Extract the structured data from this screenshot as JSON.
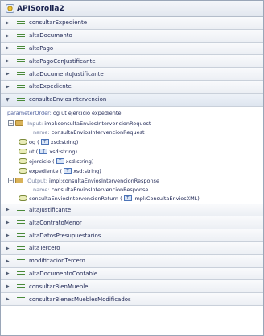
{
  "header": {
    "title": "APISorolla2"
  },
  "operations_before": [
    {
      "label": "consultarExpediente"
    },
    {
      "label": "altaDocumento"
    },
    {
      "label": "altaPago"
    },
    {
      "label": "altaPagoConJustificante"
    },
    {
      "label": "altaDocumentoJustificante"
    },
    {
      "label": "altaExpediente"
    }
  ],
  "expanded": {
    "label": "consultaEnviosIntervencion",
    "param_key": "parameterOrder:",
    "param_value": "og ut ejercicio expediente",
    "input": {
      "key": "Input:",
      "value": "impl:consultaEnviosIntervencionRequest",
      "name_key": "name:",
      "name_value": "consultaEnviosIntervencionRequest",
      "parts": [
        {
          "name": "og (",
          "type_icon": "T",
          "type": "xsd:string)"
        },
        {
          "name": "ut (",
          "type_icon": "T",
          "type": "xsd:string)"
        },
        {
          "name": "ejercicio (",
          "type_icon": "T",
          "type": "xsd:string)"
        },
        {
          "name": "expediente (",
          "type_icon": "T",
          "type": "xsd:string)"
        }
      ]
    },
    "output": {
      "key": "Output:",
      "value": "impl:consultaEnviosIntervencionResponse",
      "name_key": "name:",
      "name_value": "consultaEnviosIntervencionResponse",
      "part": {
        "name": "consultaEnviosIntervencionReturn (",
        "type_icon": "T",
        "type": "impl:ConsultaEnviosXML)"
      }
    }
  },
  "operations_after": [
    {
      "label": "altaJustificante"
    },
    {
      "label": "altaContratoMenor"
    },
    {
      "label": "altaDatosPresupuestarios"
    },
    {
      "label": "altaTercero"
    },
    {
      "label": "modificacionTercero"
    },
    {
      "label": "altaDocumentoContable"
    },
    {
      "label": "consultarBienMueble"
    },
    {
      "label": "consultarBienesMueblesModificados"
    }
  ]
}
